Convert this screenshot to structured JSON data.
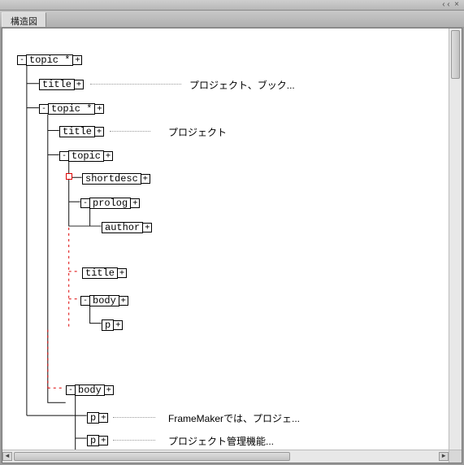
{
  "tab_title": "構造図",
  "glyphs": {
    "minimize": "‹‹",
    "close": "×",
    "expand": "-",
    "collapse": "+"
  },
  "nodes": {
    "n1": {
      "label": "topic *"
    },
    "n2": {
      "label": "title",
      "preview": "プロジェクト、ブック..."
    },
    "n3": {
      "label": "topic *"
    },
    "n4": {
      "label": "title",
      "preview": "プロジェクト"
    },
    "n5": {
      "label": "topic"
    },
    "n6": {
      "label": "shortdesc"
    },
    "n7": {
      "label": "prolog"
    },
    "n8": {
      "label": "author"
    },
    "n9": {
      "label": "title"
    },
    "n10": {
      "label": "body"
    },
    "n11": {
      "label": "p"
    },
    "n12": {
      "label": "body"
    },
    "n13": {
      "label": "p",
      "preview": "FrameMakerでは、プロジェ..."
    },
    "n14": {
      "label": "p",
      "preview": "プロジェクト管理機能..."
    }
  }
}
